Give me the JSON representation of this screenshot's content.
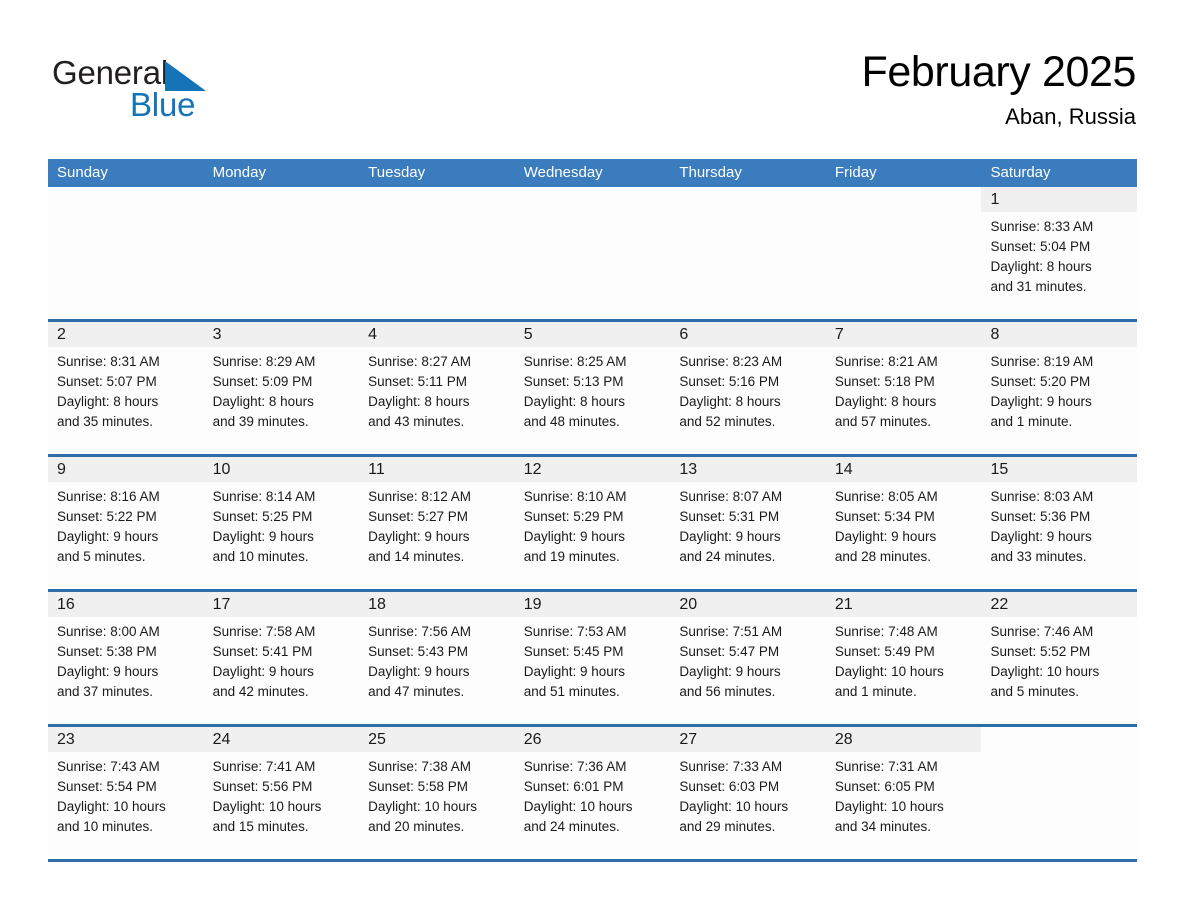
{
  "logo": {
    "word1": "General",
    "word2": "Blue",
    "triangle_color": "#1574b8",
    "text_color": "#231f20"
  },
  "header": {
    "month_title": "February 2025",
    "location": "Aban, Russia"
  },
  "theme": {
    "header_blue": "#3a7cbe",
    "rule_blue": "#2e6da8",
    "day_band_gray": "#f0f0f0",
    "page_background": "#ffffff"
  },
  "calendar": {
    "weekdays": [
      "Sunday",
      "Monday",
      "Tuesday",
      "Wednesday",
      "Thursday",
      "Friday",
      "Saturday"
    ],
    "weeks": [
      [
        {
          "day": "",
          "blank": true
        },
        {
          "day": "",
          "blank": true
        },
        {
          "day": "",
          "blank": true
        },
        {
          "day": "",
          "blank": true
        },
        {
          "day": "",
          "blank": true
        },
        {
          "day": "",
          "blank": true
        },
        {
          "day": "1",
          "sunrise": "Sunrise: 8:33 AM",
          "sunset": "Sunset: 5:04 PM",
          "daylight1": "Daylight: 8 hours",
          "daylight2": "and 31 minutes."
        }
      ],
      [
        {
          "day": "2",
          "sunrise": "Sunrise: 8:31 AM",
          "sunset": "Sunset: 5:07 PM",
          "daylight1": "Daylight: 8 hours",
          "daylight2": "and 35 minutes."
        },
        {
          "day": "3",
          "sunrise": "Sunrise: 8:29 AM",
          "sunset": "Sunset: 5:09 PM",
          "daylight1": "Daylight: 8 hours",
          "daylight2": "and 39 minutes."
        },
        {
          "day": "4",
          "sunrise": "Sunrise: 8:27 AM",
          "sunset": "Sunset: 5:11 PM",
          "daylight1": "Daylight: 8 hours",
          "daylight2": "and 43 minutes."
        },
        {
          "day": "5",
          "sunrise": "Sunrise: 8:25 AM",
          "sunset": "Sunset: 5:13 PM",
          "daylight1": "Daylight: 8 hours",
          "daylight2": "and 48 minutes."
        },
        {
          "day": "6",
          "sunrise": "Sunrise: 8:23 AM",
          "sunset": "Sunset: 5:16 PM",
          "daylight1": "Daylight: 8 hours",
          "daylight2": "and 52 minutes."
        },
        {
          "day": "7",
          "sunrise": "Sunrise: 8:21 AM",
          "sunset": "Sunset: 5:18 PM",
          "daylight1": "Daylight: 8 hours",
          "daylight2": "and 57 minutes."
        },
        {
          "day": "8",
          "sunrise": "Sunrise: 8:19 AM",
          "sunset": "Sunset: 5:20 PM",
          "daylight1": "Daylight: 9 hours",
          "daylight2": "and 1 minute."
        }
      ],
      [
        {
          "day": "9",
          "sunrise": "Sunrise: 8:16 AM",
          "sunset": "Sunset: 5:22 PM",
          "daylight1": "Daylight: 9 hours",
          "daylight2": "and 5 minutes."
        },
        {
          "day": "10",
          "sunrise": "Sunrise: 8:14 AM",
          "sunset": "Sunset: 5:25 PM",
          "daylight1": "Daylight: 9 hours",
          "daylight2": "and 10 minutes."
        },
        {
          "day": "11",
          "sunrise": "Sunrise: 8:12 AM",
          "sunset": "Sunset: 5:27 PM",
          "daylight1": "Daylight: 9 hours",
          "daylight2": "and 14 minutes."
        },
        {
          "day": "12",
          "sunrise": "Sunrise: 8:10 AM",
          "sunset": "Sunset: 5:29 PM",
          "daylight1": "Daylight: 9 hours",
          "daylight2": "and 19 minutes."
        },
        {
          "day": "13",
          "sunrise": "Sunrise: 8:07 AM",
          "sunset": "Sunset: 5:31 PM",
          "daylight1": "Daylight: 9 hours",
          "daylight2": "and 24 minutes."
        },
        {
          "day": "14",
          "sunrise": "Sunrise: 8:05 AM",
          "sunset": "Sunset: 5:34 PM",
          "daylight1": "Daylight: 9 hours",
          "daylight2": "and 28 minutes."
        },
        {
          "day": "15",
          "sunrise": "Sunrise: 8:03 AM",
          "sunset": "Sunset: 5:36 PM",
          "daylight1": "Daylight: 9 hours",
          "daylight2": "and 33 minutes."
        }
      ],
      [
        {
          "day": "16",
          "sunrise": "Sunrise: 8:00 AM",
          "sunset": "Sunset: 5:38 PM",
          "daylight1": "Daylight: 9 hours",
          "daylight2": "and 37 minutes."
        },
        {
          "day": "17",
          "sunrise": "Sunrise: 7:58 AM",
          "sunset": "Sunset: 5:41 PM",
          "daylight1": "Daylight: 9 hours",
          "daylight2": "and 42 minutes."
        },
        {
          "day": "18",
          "sunrise": "Sunrise: 7:56 AM",
          "sunset": "Sunset: 5:43 PM",
          "daylight1": "Daylight: 9 hours",
          "daylight2": "and 47 minutes."
        },
        {
          "day": "19",
          "sunrise": "Sunrise: 7:53 AM",
          "sunset": "Sunset: 5:45 PM",
          "daylight1": "Daylight: 9 hours",
          "daylight2": "and 51 minutes."
        },
        {
          "day": "20",
          "sunrise": "Sunrise: 7:51 AM",
          "sunset": "Sunset: 5:47 PM",
          "daylight1": "Daylight: 9 hours",
          "daylight2": "and 56 minutes."
        },
        {
          "day": "21",
          "sunrise": "Sunrise: 7:48 AM",
          "sunset": "Sunset: 5:49 PM",
          "daylight1": "Daylight: 10 hours",
          "daylight2": "and 1 minute."
        },
        {
          "day": "22",
          "sunrise": "Sunrise: 7:46 AM",
          "sunset": "Sunset: 5:52 PM",
          "daylight1": "Daylight: 10 hours",
          "daylight2": "and 5 minutes."
        }
      ],
      [
        {
          "day": "23",
          "sunrise": "Sunrise: 7:43 AM",
          "sunset": "Sunset: 5:54 PM",
          "daylight1": "Daylight: 10 hours",
          "daylight2": "and 10 minutes."
        },
        {
          "day": "24",
          "sunrise": "Sunrise: 7:41 AM",
          "sunset": "Sunset: 5:56 PM",
          "daylight1": "Daylight: 10 hours",
          "daylight2": "and 15 minutes."
        },
        {
          "day": "25",
          "sunrise": "Sunrise: 7:38 AM",
          "sunset": "Sunset: 5:58 PM",
          "daylight1": "Daylight: 10 hours",
          "daylight2": "and 20 minutes."
        },
        {
          "day": "26",
          "sunrise": "Sunrise: 7:36 AM",
          "sunset": "Sunset: 6:01 PM",
          "daylight1": "Daylight: 10 hours",
          "daylight2": "and 24 minutes."
        },
        {
          "day": "27",
          "sunrise": "Sunrise: 7:33 AM",
          "sunset": "Sunset: 6:03 PM",
          "daylight1": "Daylight: 10 hours",
          "daylight2": "and 29 minutes."
        },
        {
          "day": "28",
          "sunrise": "Sunrise: 7:31 AM",
          "sunset": "Sunset: 6:05 PM",
          "daylight1": "Daylight: 10 hours",
          "daylight2": "and 34 minutes."
        },
        {
          "day": "",
          "blank": true
        }
      ]
    ]
  }
}
